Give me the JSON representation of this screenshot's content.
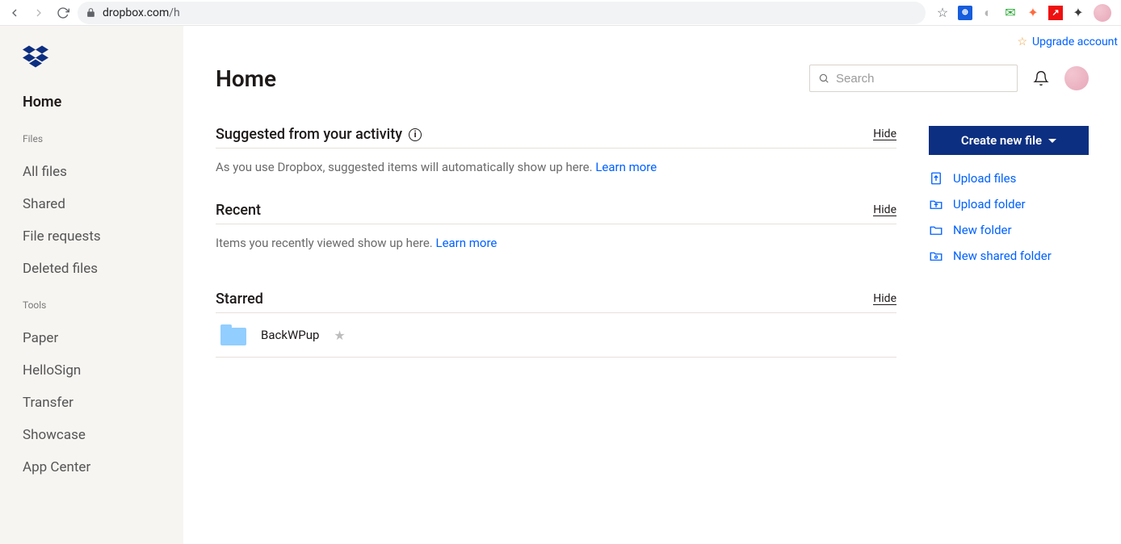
{
  "browser": {
    "url_host": "dropbox.com",
    "url_path": "/h",
    "ext_icons": [
      "star-icon",
      "bitwarden-icon",
      "grammarly-icon",
      "mail-icon",
      "fox-icon",
      "redirect-icon",
      "puzzle-icon"
    ]
  },
  "upgrade": {
    "label": "Upgrade account"
  },
  "sidebar": {
    "active": "Home",
    "files_label": "Files",
    "files_items": [
      "All files",
      "Shared",
      "File requests",
      "Deleted files"
    ],
    "tools_label": "Tools",
    "tools_items": [
      "Paper",
      "HelloSign",
      "Transfer",
      "Showcase",
      "App Center"
    ]
  },
  "header": {
    "title": "Home",
    "search_placeholder": "Search"
  },
  "sections": {
    "suggested": {
      "title": "Suggested from your activity",
      "hide": "Hide",
      "text": "As you use Dropbox, suggested items will automatically show up here. ",
      "link": "Learn more"
    },
    "recent": {
      "title": "Recent",
      "hide": "Hide",
      "text": "Items you recently viewed show up here. ",
      "link": "Learn more"
    },
    "starred": {
      "title": "Starred",
      "hide": "Hide",
      "items": [
        {
          "name": "BackWPup"
        }
      ]
    }
  },
  "right": {
    "create": "Create new file",
    "actions": [
      "Upload files",
      "Upload folder",
      "New folder",
      "New shared folder"
    ]
  }
}
